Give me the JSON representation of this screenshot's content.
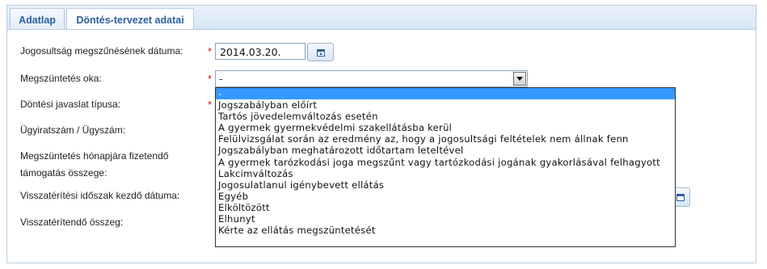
{
  "tabs": [
    {
      "label": "Adatlap",
      "active": false
    },
    {
      "label": "Döntés-tervezet adatai",
      "active": true
    }
  ],
  "form": {
    "end_date_label": "Jogosultság megszűnésének dátuma:",
    "end_date_value": "2014.03.20.",
    "reason_label": "Megszüntetés oka:",
    "reason_value": "-",
    "proposal_type_label": "Döntési javaslat típusa:",
    "file_number_label": "Ügyiratszám / Ügyszám:",
    "amount_label_line1": "Megszüntetés hónapjára fizetendő",
    "amount_label_line2": "támogatás összege:",
    "refund_start_label": "Visszatérítési időszak kezdő dátuma:",
    "refund_amount_label": "Visszatérítendő összeg:",
    "required_mark": "*"
  },
  "dropdown": {
    "selected_index": 0,
    "options": [
      "-",
      "Jogszabályban előírt",
      "Tartós jövedelemváltozás esetén",
      "A gyermek gyermekvédelmi szakellátásba kerül",
      "Felülvizsgálat során az eredmény az, hogy a jogosultsági feltételek nem állnak fenn",
      "Jogszabályban meghatározott időtartam leteltével",
      "A gyermek tarózkodási joga megszűnt vagy tartózkodási jogának gyakorlásával felhagyott",
      "Lakcimváltozás",
      "Jogosulatlanul igénybevett ellátás",
      "Egyéb",
      "Elköltözött",
      "Elhunyt",
      "Kérte az ellátás megszüntetését"
    ]
  },
  "colors": {
    "accent": "#2a5f9e",
    "selected": "#3399ff",
    "required": "#d01010"
  },
  "icons": {
    "calendar": "calendar-icon",
    "dropdown": "chevron-down-icon"
  }
}
